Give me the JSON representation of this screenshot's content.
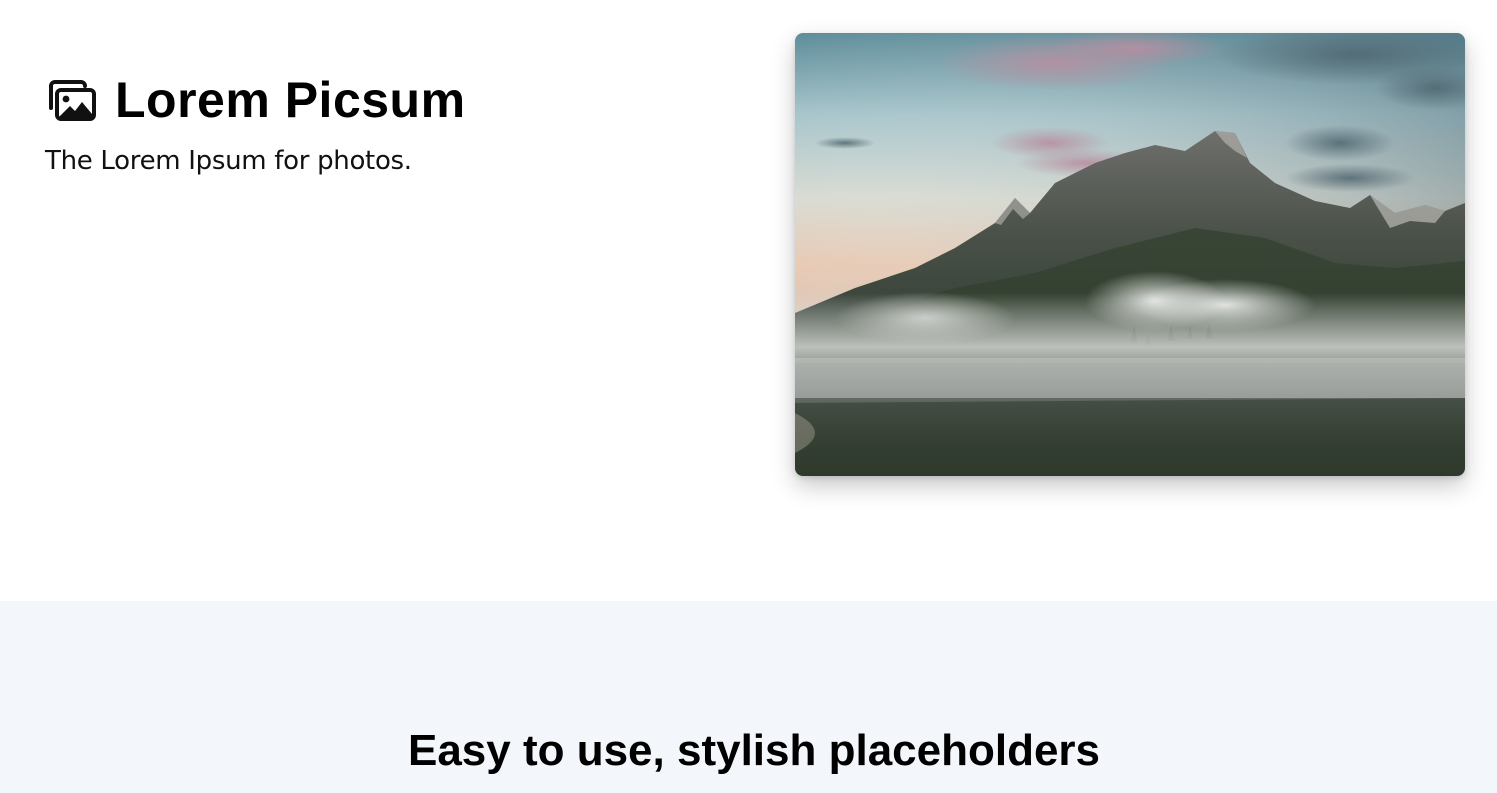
{
  "brand": {
    "title": "Lorem Picsum",
    "icon": "images-icon"
  },
  "hero": {
    "tagline": "The Lorem Ipsum for photos.",
    "photo": "mountain-lake-fog-photo"
  },
  "features": {
    "heading": "Easy to use, stylish placeholders",
    "background": "#f3f6fa"
  }
}
